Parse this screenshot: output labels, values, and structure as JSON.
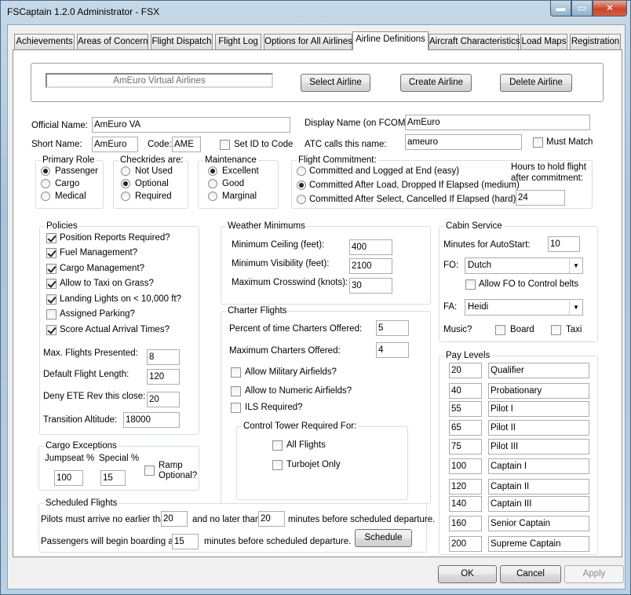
{
  "window": {
    "title": "FSCaptain 1.2.0 Administrator - FSX",
    "min_glyph": "▬",
    "max_glyph": "▭",
    "close_glyph": "✕"
  },
  "tabs": [
    "Achievements",
    "Areas of Concern",
    "Flight Dispatch",
    "Flight Log",
    "Options for All Airlines",
    "Airline Definitions",
    "Aircraft Characteristics",
    "Load Maps",
    "Registration"
  ],
  "airline_select": {
    "current": "AmEuro Virtual Airlines",
    "select_label": "Select Airline",
    "create_label": "Create Airline",
    "delete_label": "Delete Airline"
  },
  "identity": {
    "official_name_label": "Official Name:",
    "official_name": "AmEuro VA",
    "display_name_label": "Display Name (on FCOM):",
    "display_name": "AmEuro",
    "short_name_label": "Short Name:",
    "short_name": "AmEuro",
    "code_label": "Code:",
    "code": "AME",
    "set_id_label": "Set ID to Code",
    "atc_label": "ATC calls this name:",
    "atc_name": "ameuro",
    "must_match_label": "Must Match"
  },
  "primary_role": {
    "title": "Primary Role",
    "options": [
      "Passenger",
      "Cargo",
      "Medical"
    ]
  },
  "checkrides": {
    "title": "Checkrides are:",
    "options": [
      "Not Used",
      "Optional",
      "Required"
    ]
  },
  "maintenance": {
    "title": "Maintenance",
    "options": [
      "Excellent",
      "Good",
      "Marginal"
    ]
  },
  "flight_commitment": {
    "title": "Flight Commitment:",
    "options": [
      "Committed and Logged at End (easy)",
      "Committed After Load, Dropped If Elapsed (medium)",
      "Committed After Select, Cancelled If Elapsed (hard)"
    ],
    "hours_label_1": "Hours to hold flight",
    "hours_label_2": "after commitment:",
    "hours": "24"
  },
  "policies": {
    "title": "Policies",
    "items": [
      "Position Reports Required?",
      "Fuel Management?",
      "Cargo Management?",
      "Allow to Taxi on Grass?",
      "Landing Lights on < 10,000 ft?",
      "Assigned Parking?",
      "Score Actual Arrival Times?"
    ],
    "max_flights_label": "Max. Flights Presented:",
    "max_flights": "8",
    "default_length_label": "Default Flight Length:",
    "default_length": "120",
    "deny_ete_label": "Deny ETE Rev this close:",
    "deny_ete": "20",
    "transition_label": "Transition Altitude:",
    "transition": "18000"
  },
  "weather": {
    "title": "Weather Minimums",
    "ceiling_label": "Minimum Ceiling (feet):",
    "ceiling": "400",
    "visibility_label": "Minimum Visibility (feet):",
    "visibility": "2100",
    "crosswind_label": "Maximum Crosswind (knots):",
    "crosswind": "30"
  },
  "charter": {
    "title": "Charter Flights",
    "percent_label": "Percent of time Charters Offered:",
    "percent": "5",
    "max_label": "Maximum Charters Offered:",
    "max": "4",
    "military_label": "Allow Military Airfields?",
    "numeric_label": "Allow to Numeric Airfields?",
    "ils_label": "ILS Required?",
    "tower_title": "Control Tower Required For:",
    "all_flights_label": "All Flights",
    "turbojet_label": "Turbojet Only"
  },
  "cabin": {
    "title": "Cabin Service",
    "autostart_label": "Minutes for AutoStart:",
    "autostart": "10",
    "fo_label": "FO:",
    "fo": "Dutch",
    "fo_belts_label": "Allow FO to Control belts",
    "fa_label": "FA:",
    "fa": "Heidi",
    "music_label": "Music?",
    "board_label": "Board",
    "taxi_label": "Taxi"
  },
  "pay_levels": {
    "title": "Pay Levels",
    "levels": [
      {
        "value": "20",
        "name": "Qualifier"
      },
      {
        "value": "40",
        "name": "Probationary"
      },
      {
        "value": "55",
        "name": "Pilot I"
      },
      {
        "value": "65",
        "name": "Pilot II"
      },
      {
        "value": "75",
        "name": "Pilot III"
      },
      {
        "value": "100",
        "name": "Captain I"
      },
      {
        "value": "120",
        "name": "Captain II"
      },
      {
        "value": "140",
        "name": "Captain III"
      },
      {
        "value": "160",
        "name": "Senior Captain"
      },
      {
        "value": "200",
        "name": "Supreme Captain"
      }
    ]
  },
  "cargo_exceptions": {
    "title": "Cargo Exceptions",
    "jumpseat_label": "Jumpseat %",
    "jumpseat": "100",
    "special_label": "Special %",
    "special": "15",
    "ramp_label_1": "Ramp",
    "ramp_label_2": "Optional?"
  },
  "scheduled": {
    "title": "Scheduled Flights",
    "arrive_label": "Pilots must arrive no earlier than",
    "arrive_earliest": "20",
    "and_label": "and no later than",
    "arrive_latest": "20",
    "before_label": "minutes before scheduled departure.",
    "boarding_label": "Passengers will begin boarding at",
    "boarding": "15",
    "boarding_after": "minutes before scheduled departure.",
    "schedule_button": "Schedule"
  },
  "footer": {
    "ok": "OK",
    "cancel": "Cancel",
    "apply": "Apply"
  }
}
